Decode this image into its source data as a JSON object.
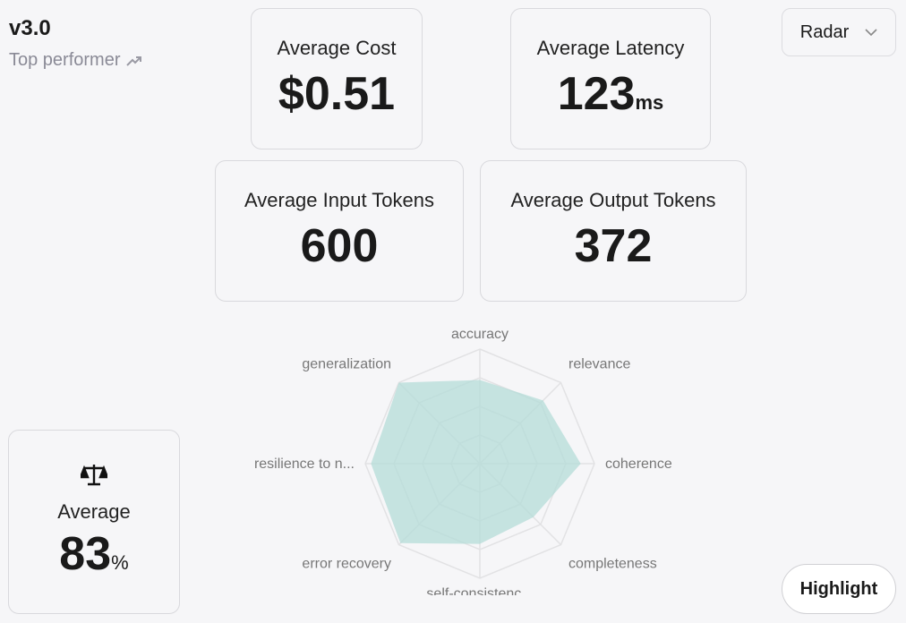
{
  "header": {
    "version": "v3.0",
    "subtitle": "Top performer",
    "subtitle_icon": "trending-up-icon"
  },
  "view_select": {
    "value": "Radar"
  },
  "metrics": {
    "cost": {
      "label": "Average Cost",
      "value": "$0.51"
    },
    "latency": {
      "label": "Average Latency",
      "value": "123",
      "unit": "ms"
    },
    "input_tokens": {
      "label": "Average Input Tokens",
      "value": "600"
    },
    "output_tokens": {
      "label": "Average Output Tokens",
      "value": "372"
    }
  },
  "average": {
    "icon": "scale-icon",
    "label": "Average",
    "value": "83",
    "unit": "%"
  },
  "highlight_button": "Highlight",
  "chart_data": {
    "type": "radar",
    "categories": [
      "accuracy",
      "relevance",
      "coherence",
      "completeness",
      "self-consistenc...",
      "error recovery",
      "resilience to n...",
      "generalization"
    ],
    "values": [
      0.73,
      0.78,
      0.88,
      0.66,
      0.7,
      0.98,
      0.95,
      1.0
    ],
    "range": [
      0,
      1
    ],
    "rings": 4,
    "fill_color": "#b4dcd8"
  }
}
